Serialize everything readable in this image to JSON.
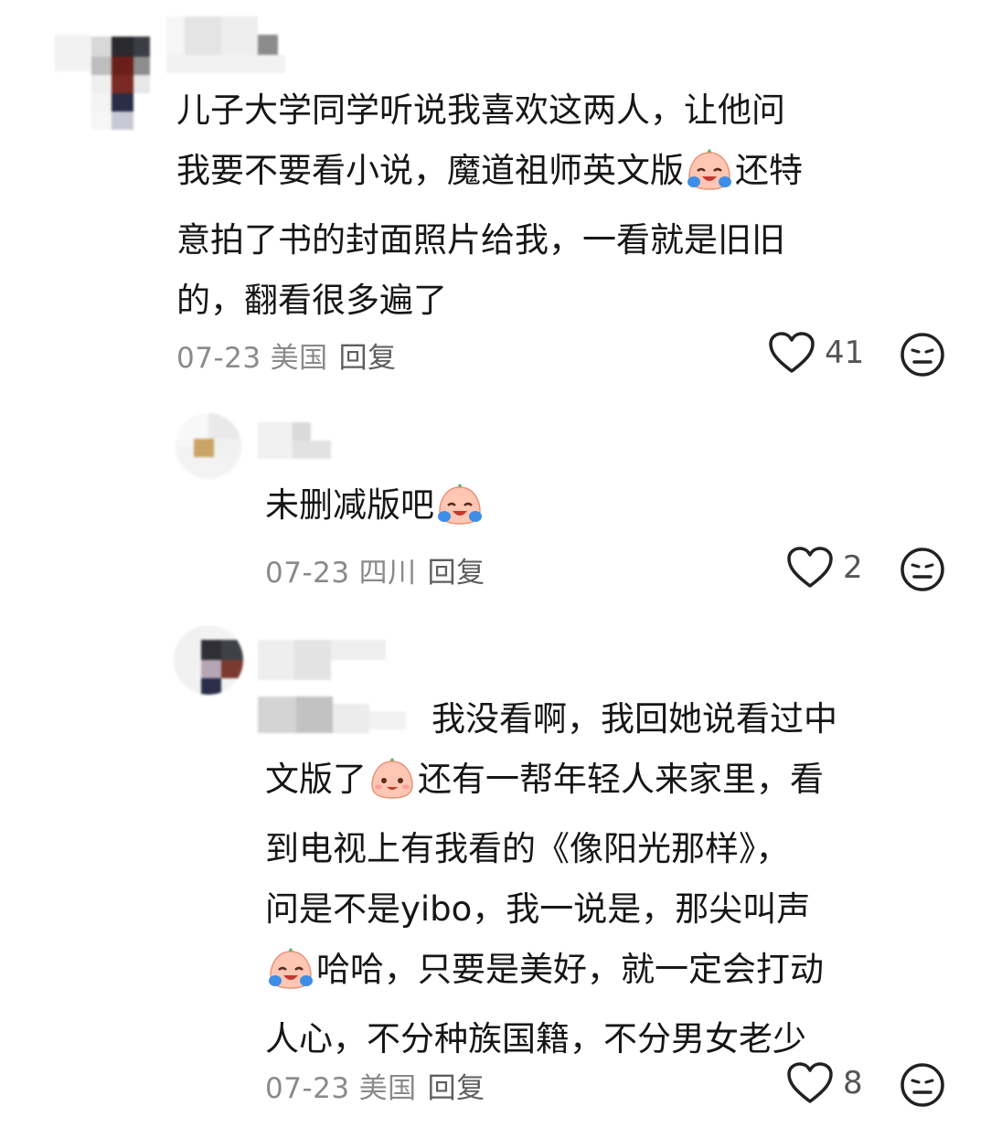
{
  "comments": [
    {
      "text_lines": [
        "儿子大学同学听说我喜欢这两人，让他问",
        "我要不要看小说，魔道祖师英文版",
        "意拍了书的封面照片给我，一看就是旧旧",
        "的，翻看很多遍了"
      ],
      "line2_after_emoji": "还特",
      "date": "07-23",
      "location": "美国",
      "reply_label": "回复",
      "likes": "41"
    },
    {
      "text": "未删减版吧",
      "date": "07-23",
      "location": "四川",
      "reply_label": "回复",
      "likes": "2"
    },
    {
      "line1": "我没看啊，我回她说看过中",
      "line2_a": "文版了",
      "line2_b": "还有一帮年轻人来家里，看",
      "line3": "到电视上有我看的《像阳光那样》，",
      "line4": "问是不是yibo，我一说是，那尖叫声",
      "line5": "哈哈，只要是美好，就一定会打动",
      "line6": "人心，不分种族国籍，不分男女老少",
      "date": "07-23",
      "location": "美国",
      "reply_label": "回复",
      "likes": "8"
    }
  ],
  "icons": [
    "heart-outline-icon",
    "dislike-face-icon",
    "laughing-tears-emoji",
    "smiling-emoji"
  ]
}
